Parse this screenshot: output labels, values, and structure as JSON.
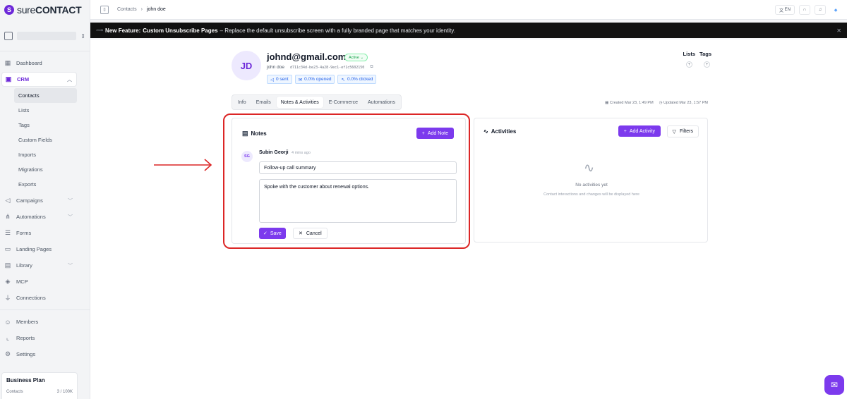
{
  "brand": {
    "logo_mark": "S",
    "name_bold": "sure",
    "name_rest": "CONTACT"
  },
  "sidebar": {
    "items_top": [
      {
        "label": "Dashboard",
        "icon": "dashboard-icon"
      }
    ],
    "crm": {
      "label": "CRM",
      "icon": "crm-icon"
    },
    "crm_sub": [
      "Contacts",
      "Lists",
      "Tags",
      "Custom Fields",
      "Imports",
      "Migrations",
      "Exports"
    ],
    "items_mid": [
      {
        "label": "Campaigns",
        "icon": "megaphone-icon",
        "has_chevron": true
      },
      {
        "label": "Automations",
        "icon": "automation-icon",
        "has_chevron": true
      },
      {
        "label": "Forms",
        "icon": "form-icon"
      },
      {
        "label": "Landing Pages",
        "icon": "landing-page-icon"
      },
      {
        "label": "Library",
        "icon": "library-icon",
        "has_chevron": true
      },
      {
        "label": "MCP",
        "icon": "mcp-icon"
      },
      {
        "label": "Connections",
        "icon": "plug-icon"
      }
    ],
    "items_bottom": [
      {
        "label": "Members",
        "icon": "members-icon"
      },
      {
        "label": "Reports",
        "icon": "reports-icon"
      },
      {
        "label": "Settings",
        "icon": "gear-icon"
      }
    ],
    "plan": {
      "title": "Business Plan",
      "label": "Contacts",
      "value": "3 / 100K"
    }
  },
  "topbar": {
    "breadcrumb": [
      "Contacts",
      "john doe"
    ],
    "lang": "EN"
  },
  "banner": {
    "lead": "New Feature:",
    "title": "Custom Unsubscribe Pages",
    "text": "– Replace the default unsubscribe screen with a fully branded page that matches your identity."
  },
  "contact": {
    "initials": "JD",
    "email": "johnd@gmail.com",
    "status": "Active ⌄",
    "name": "john doe",
    "uuid": "d711c34d-be23-4a28-9ec1-ef1c5602150",
    "stats": [
      "0 sent",
      "0.0% opened",
      "0.0% clicked"
    ],
    "lists_label": "Lists",
    "tags_label": "Tags"
  },
  "tabs": [
    "Info",
    "Emails",
    "Notes & Activities",
    "E-Commerce",
    "Automations"
  ],
  "active_tab": "Notes & Activities",
  "meta": {
    "created": "Created Mar 23, 1:49 PM",
    "updated": "Updated Mar 23, 1:57 PM"
  },
  "notes": {
    "title": "Notes",
    "add_label": "Add Note",
    "author_initials": "SG",
    "author": "Subin Georji",
    "time": "4 mins ago",
    "note_title": "Follow-up call summary",
    "note_body": "Spoke with the customer about renewal options.",
    "save_label": "Save",
    "cancel_label": "Cancel"
  },
  "activities": {
    "title": "Activities",
    "add_label": "Add Activity",
    "filters_label": "Filters",
    "empty_title": "No activities yet",
    "empty_sub": "Contact interactions and changes will be displayed here"
  },
  "colors": {
    "brand": "#7c3aed",
    "highlight": "#dc2626",
    "banner_bg": "#111111"
  }
}
